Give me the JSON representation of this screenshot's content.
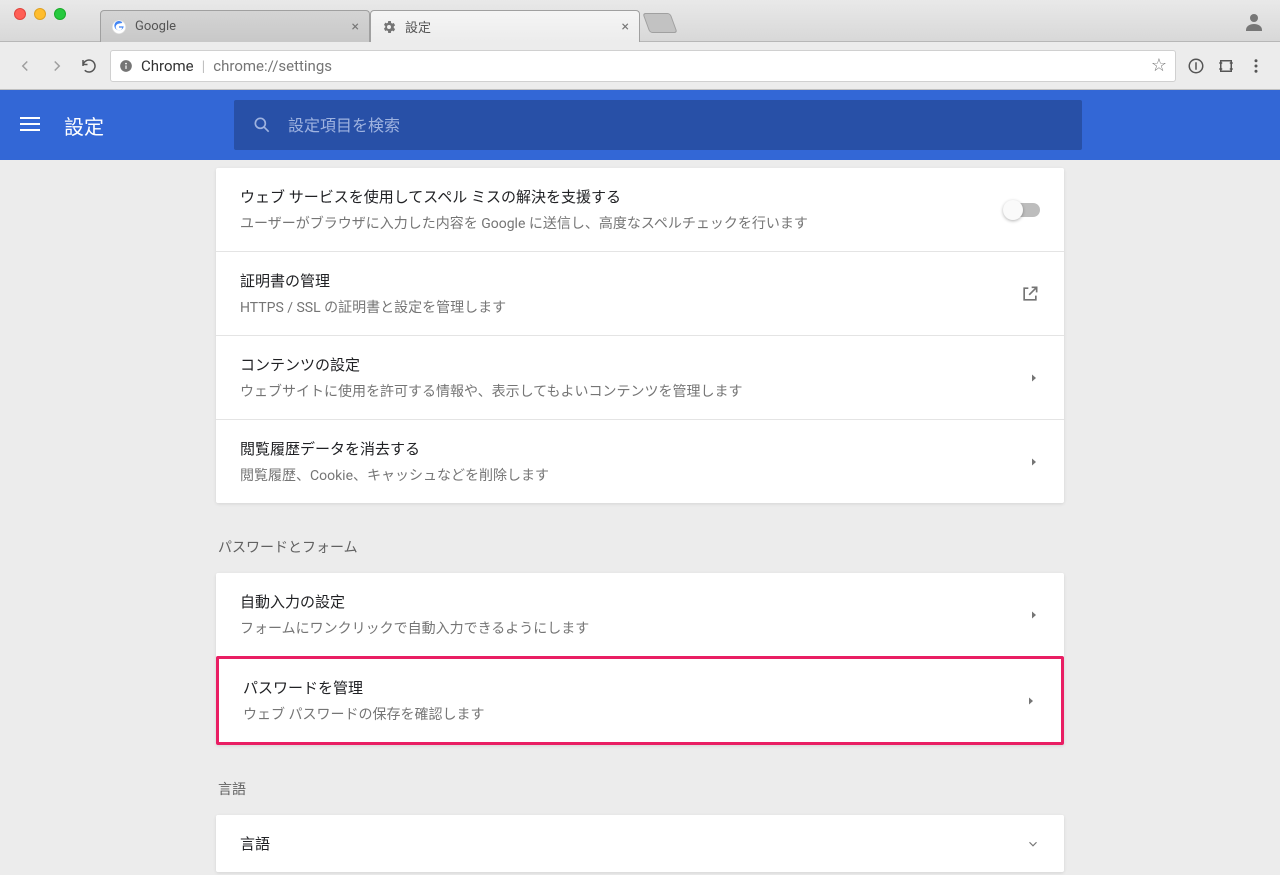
{
  "tabs": [
    {
      "title": "Google",
      "icon": "google"
    },
    {
      "title": "設定",
      "icon": "gear"
    }
  ],
  "omnibox": {
    "label": "Chrome",
    "url": "chrome://settings"
  },
  "header": {
    "title": "設定",
    "search_placeholder": "設定項目を検索"
  },
  "sections": {
    "privacy": {
      "items": [
        {
          "title": "ウェブ サービスを使用してスペル ミスの解決を支援する",
          "desc": "ユーザーがブラウザに入力した内容を Google に送信し、高度なスペルチェックを行います",
          "control": "toggle"
        },
        {
          "title": "証明書の管理",
          "desc": "HTTPS / SSL の証明書と設定を管理します",
          "control": "external"
        },
        {
          "title": "コンテンツの設定",
          "desc": "ウェブサイトに使用を許可する情報や、表示してもよいコンテンツを管理します",
          "control": "arrow"
        },
        {
          "title": "閲覧履歴データを消去する",
          "desc": "閲覧履歴、Cookie、キャッシュなどを削除します",
          "control": "arrow"
        }
      ]
    },
    "passwords": {
      "label": "パスワードとフォーム",
      "items": [
        {
          "title": "自動入力の設定",
          "desc": "フォームにワンクリックで自動入力できるようにします",
          "control": "arrow"
        },
        {
          "title": "パスワードを管理",
          "desc": "ウェブ パスワードの保存を確認します",
          "control": "arrow",
          "highlighted": true
        }
      ]
    },
    "language": {
      "label": "言語",
      "items": [
        {
          "title": "言語",
          "control": "expand"
        }
      ]
    }
  }
}
